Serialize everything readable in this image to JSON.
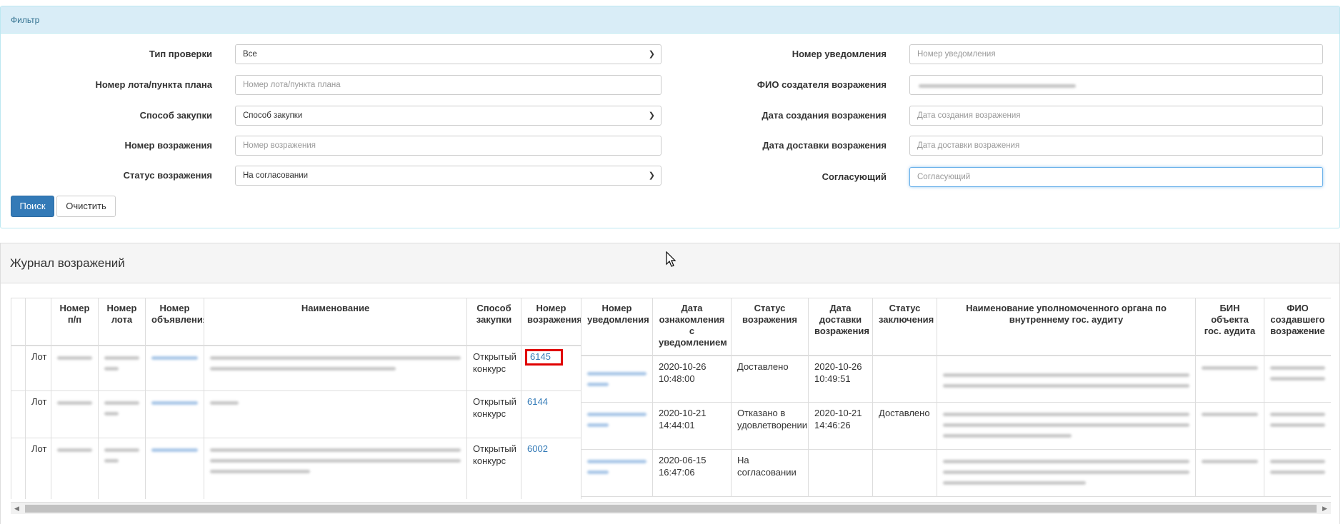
{
  "filter": {
    "title": "Фильтр",
    "check_type": {
      "label": "Тип проверки",
      "value": "Все"
    },
    "lot_number": {
      "label": "Номер лота/пункта плана",
      "placeholder": "Номер лота/пункта плана"
    },
    "purchase_method": {
      "label": "Способ закупки",
      "value": "Способ закупки"
    },
    "objection_number": {
      "label": "Номер возражения",
      "placeholder": "Номер возражения"
    },
    "objection_status": {
      "label": "Статус возражения",
      "value": "На согласовании"
    },
    "notice_number": {
      "label": "Номер уведомления",
      "placeholder": "Номер уведомления"
    },
    "creator_name": {
      "label": "ФИО создателя возражения"
    },
    "creation_date": {
      "label": "Дата создания возражения",
      "placeholder": "Дата создания возражения"
    },
    "delivery_date": {
      "label": "Дата доставки возражения",
      "placeholder": "Дата доставки возражения"
    },
    "approver": {
      "label": "Согласующий",
      "placeholder": "Согласующий"
    },
    "search_button": "Поиск",
    "clear_button": "Очистить"
  },
  "journal": {
    "title": "Журнал возражений",
    "headers_left": [
      "",
      "Номер п/п",
      "Номер лота",
      "Номер объявления",
      "Наименование",
      "Способ закупки",
      "Номер возражения"
    ],
    "headers_right": [
      "Номер уведомления",
      "Дата ознакомления с уведомлением",
      "Статус возражения",
      "Дата доставки возражения",
      "Статус заключения",
      "Наименование уполномоченного органа по внутреннему гос. аудиту",
      "БИН объекта гос. аудита",
      "ФИО создавшего возражение"
    ],
    "rows_left": [
      {
        "type": "Лот",
        "method": "Открытый конкурс",
        "objection": "6145"
      },
      {
        "type": "Лот",
        "method": "Открытый конкурс",
        "objection": "6144"
      },
      {
        "type": "Лот",
        "method": "Открытый конкурс",
        "objection": "6002"
      }
    ],
    "rows_right": [
      {
        "ack_date": "2020-10-26 10:48:00",
        "status": "Доставлено",
        "delivery": "2020-10-26 10:49:51",
        "conclusion": ""
      },
      {
        "ack_date": "2020-10-21 14:44:01",
        "status": "Отказано в удовлетворении",
        "delivery": "2020-10-21 14:46:26",
        "conclusion": "Доставлено"
      },
      {
        "ack_date": "2020-06-15 16:47:06",
        "status": "На согласовании",
        "delivery": "",
        "conclusion": ""
      }
    ]
  },
  "colors": {
    "primary": "#337ab7",
    "filter_header": "#d9edf7",
    "highlight": "#e00000"
  }
}
